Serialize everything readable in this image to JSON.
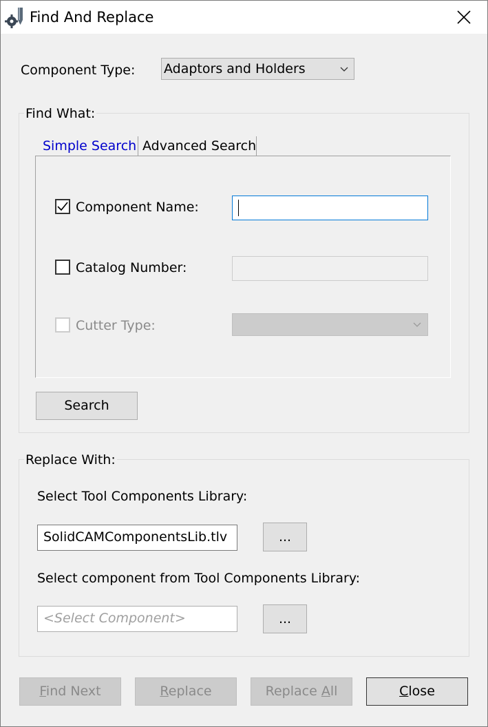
{
  "window": {
    "title": "Find And Replace",
    "icon": "solidcam-tool-gear-icon",
    "close_icon": "close-icon"
  },
  "component_type": {
    "label": "Component Type:",
    "selected": "Adaptors and Holders"
  },
  "find_what": {
    "group_label": "Find What:",
    "tabs": [
      {
        "label": "Simple Search",
        "active": true
      },
      {
        "label": "Advanced Search",
        "active": false
      }
    ],
    "component_name": {
      "label": "Component Name:",
      "checked": true,
      "value": ""
    },
    "catalog_number": {
      "label": "Catalog Number:",
      "checked": false,
      "value": ""
    },
    "cutter_type": {
      "label": "Cutter Type:",
      "checked": false,
      "disabled": true,
      "value": ""
    },
    "search_button": "Search"
  },
  "replace_with": {
    "group_label": "Replace With:",
    "library_label": "Select Tool Components Library:",
    "library_value": "SolidCAMComponentsLib.tlv",
    "library_browse": "...",
    "component_label": "Select component from Tool Components Library:",
    "component_placeholder": "<Select Component>",
    "component_browse": "..."
  },
  "footer": {
    "find_next": {
      "label": "Find Next",
      "mnemonic": "F",
      "rest": "ind Next",
      "enabled": false
    },
    "replace": {
      "label": "Replace",
      "mnemonic": "R",
      "rest": "eplace",
      "enabled": false
    },
    "replace_all": {
      "label": "Replace All",
      "before": "Replace ",
      "mnemonic": "A",
      "rest": "ll",
      "enabled": false
    },
    "close": {
      "label": "Close",
      "mnemonic": "C",
      "rest": "lose",
      "enabled": true
    }
  },
  "colors": {
    "active_tab_text": "#0000cc",
    "disabled_text": "#8a8a8a",
    "focus_border": "#0078d7",
    "placeholder_text": "#a0a0a0"
  }
}
